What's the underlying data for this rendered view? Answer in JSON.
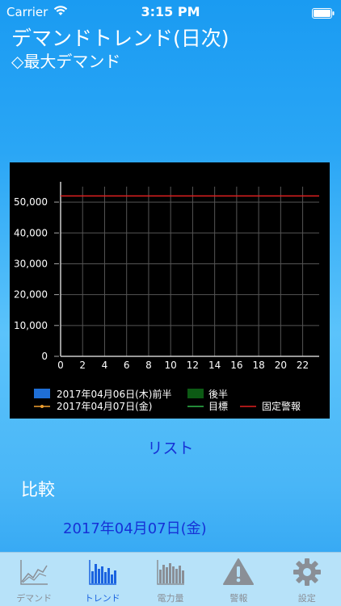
{
  "status_bar": {
    "carrier": "Carrier",
    "time": "3:15 PM"
  },
  "header": {
    "title": "デマンドトレンド(日次)",
    "subtitle": "◇最大デマンド"
  },
  "chart_data": {
    "type": "line",
    "x": [
      0,
      2,
      4,
      6,
      8,
      10,
      12,
      14,
      16,
      18,
      20,
      22
    ],
    "ylim": [
      0,
      55000
    ],
    "yticks": [
      "0",
      "10,000",
      "20,000",
      "30,000",
      "40,000",
      "50,000"
    ],
    "ytick_values": [
      0,
      10000,
      20000,
      30000,
      40000,
      50000
    ],
    "xticks": [
      "0",
      "2",
      "4",
      "6",
      "8",
      "10",
      "12",
      "14",
      "16",
      "18",
      "20",
      "22"
    ],
    "fixed_alarm": 52000,
    "series": [
      {
        "name": "2017年04月06日(木)前半",
        "color": "#1f6fd6",
        "values": []
      },
      {
        "name": "後半",
        "color": "#0c5a14",
        "values": []
      },
      {
        "name": "2017年04月07日(金)",
        "color": "#f0a030",
        "values": []
      },
      {
        "name": "目標",
        "color": "#2fb84a",
        "values": []
      },
      {
        "name": "固定警報",
        "color": "#e02020",
        "values": [
          52000,
          52000
        ]
      }
    ],
    "grid": true,
    "legend_position": "bottom"
  },
  "main": {
    "list_label": "リスト",
    "compare_label": "比較",
    "date_label": "2017年04月07日(金)"
  },
  "tabs": [
    {
      "label": "デマンド",
      "icon": "line-chart-icon",
      "active": false
    },
    {
      "label": "トレンド",
      "icon": "bar-chart-icon",
      "active": true
    },
    {
      "label": "電力量",
      "icon": "bar-chart-icon",
      "active": false
    },
    {
      "label": "警報",
      "icon": "warning-icon",
      "active": false
    },
    {
      "label": "設定",
      "icon": "gear-icon",
      "active": false
    }
  ],
  "colors": {
    "accent": "#1a63e0",
    "link": "#1631d6",
    "tab_inactive": "#8a8f96"
  }
}
